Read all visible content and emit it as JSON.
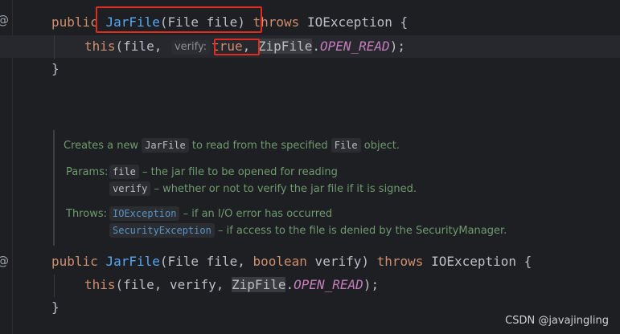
{
  "code1": {
    "line1": {
      "kw_public": "public",
      "name": "JarFile",
      "open": "(",
      "params": "File file",
      ") ": ")",
      "throws": "throws",
      "exc": "IOException",
      "brace": "{"
    },
    "line2": {
      "this": "this",
      "args_pre": "(file, ",
      "inlay": "verify:",
      "true_val": "true",
      ",": ",",
      "cls": "ZipFile",
      "dot": ".",
      "const": "OPEN_READ",
      "end": ");"
    },
    "line3": "}"
  },
  "doc": {
    "line1": {
      "pre": "Creates a new ",
      "chip1": "JarFile",
      "mid": " to read from the specified ",
      "chip2": "File",
      "post": " object."
    },
    "params_label": "Params:",
    "param1": {
      "chip": "file",
      "desc": " – the jar file to be opened for reading"
    },
    "param2": {
      "chip": "verify",
      "desc": " – whether or not to verify the jar file if it is signed."
    },
    "throws_label": "Throws:",
    "throw1": {
      "chip": "IOException",
      "desc": " – if an I/O error has occurred"
    },
    "throw2": {
      "chip": "SecurityException",
      "desc": " – if access to the file is denied by the SecurityManager."
    }
  },
  "code2": {
    "line1": {
      "kw_public": "public",
      "name": "JarFile",
      "open": "(",
      "p1": "File file, ",
      "kw_boolean": "boolean",
      "p2": " verify) ",
      "throws": "throws",
      "exc": "IOException",
      "brace": " {"
    },
    "line2": {
      "this": "this",
      "args": "(file, verify, ",
      "cls": "ZipFile",
      "dot": ".",
      "const": "OPEN_READ",
      "end": ");"
    },
    "line3": "}"
  },
  "gutter_marks": [
    "@",
    "@"
  ],
  "watermark": "CSDN @javajingling",
  "colors": {
    "background": "#1e1f22",
    "keyword": "#cf8e6d",
    "function": "#56a8f5",
    "constant": "#c77dbb",
    "annotation_box": "#e02b20",
    "doc_text": "#6f9a6f"
  }
}
